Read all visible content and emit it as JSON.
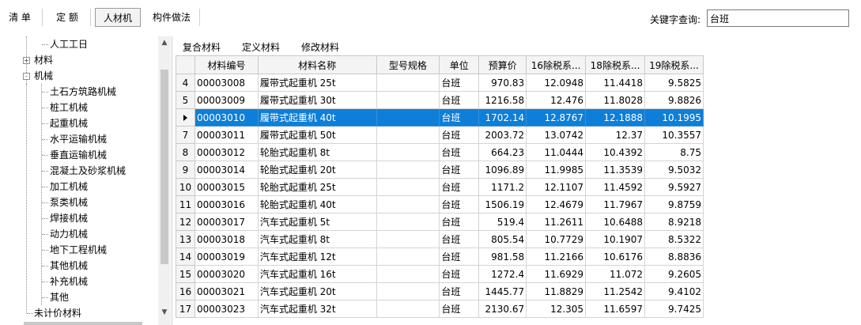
{
  "toolbar": {
    "tabs": [
      {
        "label": "清 单",
        "active": false
      },
      {
        "label": "定 额",
        "active": false
      },
      {
        "label": "人材机",
        "active": true
      },
      {
        "label": "构件做法",
        "active": false
      }
    ],
    "keyword_label": "关键字查询:",
    "keyword_value": "台班"
  },
  "tree": {
    "items": [
      {
        "label": "人工工日",
        "level": 2
      },
      {
        "label": "材料",
        "level": 1,
        "expander": "+"
      },
      {
        "label": "机械",
        "level": 1,
        "expander": "-"
      },
      {
        "label": "土石方筑路机械",
        "level": 2
      },
      {
        "label": "桩工机械",
        "level": 2
      },
      {
        "label": "起重机械",
        "level": 2
      },
      {
        "label": "水平运输机械",
        "level": 2
      },
      {
        "label": "垂直运输机械",
        "level": 2
      },
      {
        "label": "混凝土及砂浆机械",
        "level": 2
      },
      {
        "label": "加工机械",
        "level": 2
      },
      {
        "label": "泵类机械",
        "level": 2
      },
      {
        "label": "焊接机械",
        "level": 2
      },
      {
        "label": "动力机械",
        "level": 2
      },
      {
        "label": "地下工程机械",
        "level": 2
      },
      {
        "label": "其他机械",
        "level": 2
      },
      {
        "label": "补充机械",
        "level": 2
      },
      {
        "label": "其他",
        "level": 2
      },
      {
        "label": "未计价材料",
        "level": 1
      }
    ]
  },
  "grid_toolbar": [
    "复合材料",
    "定义材料",
    "修改材料"
  ],
  "table": {
    "headers": [
      "材料编号",
      "材料名称",
      "型号规格",
      "单位",
      "预算价",
      "16除税系...",
      "18除税系...",
      "19除税系..."
    ],
    "selected_marker": "▶",
    "rows": [
      {
        "rh": "4",
        "cells": [
          "00003008",
          "履带式起重机 25t",
          "",
          "台班",
          "970.83",
          "12.0948",
          "11.4418",
          "9.5825"
        ]
      },
      {
        "rh": "5",
        "cells": [
          "00003009",
          "履带式起重机 30t",
          "",
          "台班",
          "1216.58",
          "12.476",
          "11.8028",
          "9.8826"
        ]
      },
      {
        "rh": "",
        "selected": true,
        "cells": [
          "00003010",
          "履带式起重机 40t",
          "",
          "台班",
          "1702.14",
          "12.8767",
          "12.1888",
          "10.1995"
        ]
      },
      {
        "rh": "7",
        "cells": [
          "00003011",
          "履带式起重机 50t",
          "",
          "台班",
          "2003.72",
          "13.0742",
          "12.37",
          "10.3557"
        ]
      },
      {
        "rh": "8",
        "cells": [
          "00003012",
          "轮胎式起重机 8t",
          "",
          "台班",
          "664.23",
          "11.0444",
          "10.4392",
          "8.75"
        ]
      },
      {
        "rh": "9",
        "cells": [
          "00003014",
          "轮胎式起重机 20t",
          "",
          "台班",
          "1096.89",
          "11.9985",
          "11.3539",
          "9.5032"
        ]
      },
      {
        "rh": "10",
        "cells": [
          "00003015",
          "轮胎式起重机 25t",
          "",
          "台班",
          "1171.2",
          "12.1107",
          "11.4592",
          "9.5927"
        ]
      },
      {
        "rh": "11",
        "cells": [
          "00003016",
          "轮胎式起重机 40t",
          "",
          "台班",
          "1506.19",
          "12.4679",
          "11.7967",
          "9.8759"
        ]
      },
      {
        "rh": "12",
        "cells": [
          "00003017",
          "汽车式起重机 5t",
          "",
          "台班",
          "519.4",
          "11.2611",
          "10.6488",
          "8.9218"
        ]
      },
      {
        "rh": "13",
        "cells": [
          "00003018",
          "汽车式起重机 8t",
          "",
          "台班",
          "805.54",
          "10.7729",
          "10.1907",
          "8.5322"
        ]
      },
      {
        "rh": "14",
        "cells": [
          "00003019",
          "汽车式起重机 12t",
          "",
          "台班",
          "981.58",
          "11.2166",
          "10.6176",
          "8.8836"
        ]
      },
      {
        "rh": "15",
        "cells": [
          "00003020",
          "汽车式起重机 16t",
          "",
          "台班",
          "1272.4",
          "11.6929",
          "11.072",
          "9.2605"
        ]
      },
      {
        "rh": "16",
        "cells": [
          "00003021",
          "汽车式起重机 20t",
          "",
          "台班",
          "1445.77",
          "11.8829",
          "11.2542",
          "9.4102"
        ]
      },
      {
        "rh": "17",
        "cells": [
          "00003023",
          "汽车式起重机 32t",
          "",
          "台班",
          "2130.67",
          "12.305",
          "11.6597",
          "9.7425"
        ]
      }
    ]
  }
}
